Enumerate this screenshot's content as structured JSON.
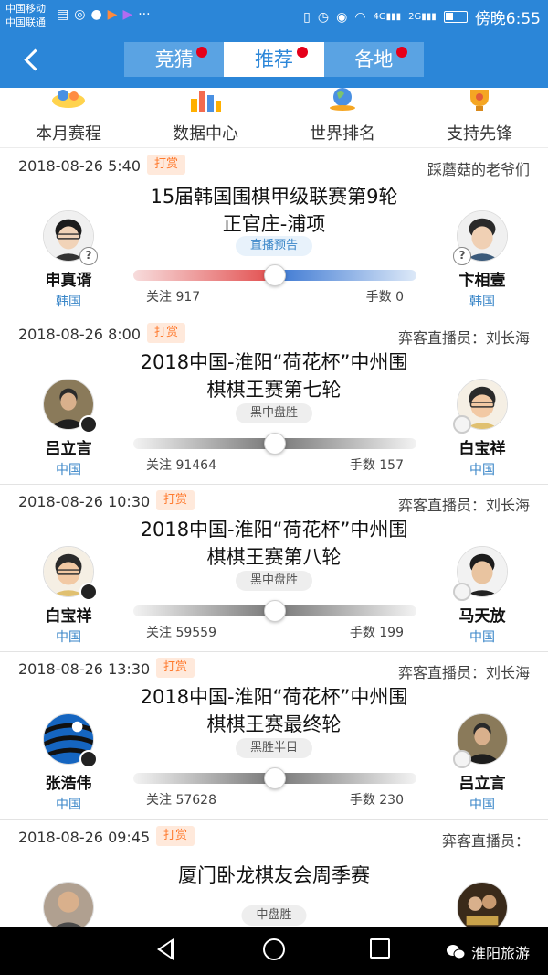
{
  "status_bar": {
    "carrier_1": "中国移动",
    "carrier_2": "中国联通",
    "signal_4g": "4G",
    "signal_2g": "2G",
    "time": "傍晚6:55"
  },
  "header": {
    "tabs": [
      {
        "label": "竞猜",
        "has_dot": true
      },
      {
        "label": "推荐",
        "has_dot": true,
        "active": true
      },
      {
        "label": "各地",
        "has_dot": true
      }
    ],
    "accent_color": "#2b86d8"
  },
  "quick_nav": [
    {
      "label": "本月赛程",
      "icon": "calendar-icon"
    },
    {
      "label": "数据中心",
      "icon": "bar-chart-icon"
    },
    {
      "label": "世界排名",
      "icon": "globe-icon"
    },
    {
      "label": "支持先锋",
      "icon": "trophy-icon"
    }
  ],
  "matches": [
    {
      "date": "2018-08-26 5:40",
      "tip": "打赏",
      "caster": "踩蘑菇的老爷们",
      "title_lines": [
        "15届韩国围棋甲级联赛第9轮",
        "正官庄-浦项"
      ],
      "badge": "直播预告",
      "left": {
        "name": "申真谞",
        "country": "韩国",
        "stone": "?"
      },
      "right": {
        "name": "卞相壹",
        "country": "韩国",
        "stone": "?"
      },
      "watch_label": "关注 917",
      "moves_label": "手数 0"
    },
    {
      "date": "2018-08-26 8:00",
      "tip": "打赏",
      "caster": "弈客直播员：刘长海",
      "title_lines": [
        "2018中国-淮阳“荷花杯”中州围",
        "棋棋王赛第七轮"
      ],
      "badge": "黑中盘胜",
      "left": {
        "name": "吕立言",
        "country": "中国",
        "stone": "black"
      },
      "right": {
        "name": "白宝祥",
        "country": "中国",
        "stone": "white"
      },
      "watch_label": "关注 91464",
      "moves_label": "手数 157"
    },
    {
      "date": "2018-08-26 10:30",
      "tip": "打赏",
      "caster": "弈客直播员：刘长海",
      "title_lines": [
        "2018中国-淮阳“荷花杯”中州围",
        "棋棋王赛第八轮"
      ],
      "badge": "黑中盘胜",
      "left": {
        "name": "白宝祥",
        "country": "中国",
        "stone": "black"
      },
      "right": {
        "name": "马天放",
        "country": "中国",
        "stone": "white"
      },
      "watch_label": "关注 59559",
      "moves_label": "手数 199"
    },
    {
      "date": "2018-08-26 13:30",
      "tip": "打赏",
      "caster": "弈客直播员：刘长海",
      "title_lines": [
        "2018中国-淮阳“荷花杯”中州围",
        "棋棋王赛最终轮"
      ],
      "badge": "黑胜半目",
      "left": {
        "name": "张浩伟",
        "country": "中国",
        "stone": "black"
      },
      "right": {
        "name": "吕立言",
        "country": "中国",
        "stone": "white"
      },
      "watch_label": "关注 57628",
      "moves_label": "手数 230"
    },
    {
      "date": "2018-08-26 09:45",
      "tip": "打赏",
      "caster": "弈客直播员：",
      "title_lines": [
        "厦门卧龙棋友会周季赛"
      ],
      "badge": "中盘胜"
    }
  ],
  "watermark": "淮阳旅游"
}
